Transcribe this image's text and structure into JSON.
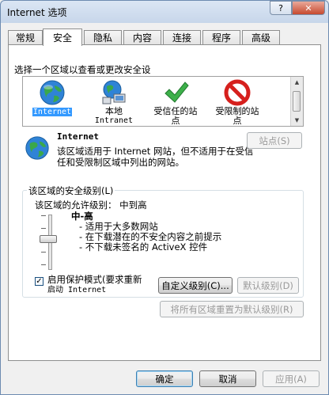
{
  "window": {
    "title": "Internet 选项",
    "help": "?",
    "close": "✕"
  },
  "tabs": [
    "常规",
    "安全",
    "隐私",
    "内容",
    "连接",
    "程序",
    "高级"
  ],
  "zones_label": "选择一个区域以查看或更改安全设",
  "zones": [
    {
      "label": "Internet",
      "icon": "globe-icon"
    },
    {
      "label": "本地",
      "label2": "Intranet",
      "icon": "intranet-globe-icon"
    },
    {
      "label": "受信任的站",
      "label2": "点",
      "icon": "checkmark-icon"
    },
    {
      "label": "受限制的站",
      "label2": "点",
      "icon": "restricted-icon"
    }
  ],
  "zone_info": {
    "title": "Internet",
    "desc": "该区域适用于 Internet 网站，但不适用于在受信任和受限制区域中列出的网站。",
    "sites_button": "站点(S)"
  },
  "security_level": {
    "group_title": "该区域的安全级别(L)",
    "allowed": "该区域的允许级别： 中到高",
    "level": "中-高",
    "bullets": [
      "- 适用于大多数网站",
      "- 在下载潜在的不安全内容之前提示",
      "- 不下载未签名的 ActiveX 控件"
    ],
    "protected_mode_line1": "启用保护模式(要求重新",
    "protected_mode_line2": "启动 Internet",
    "protected_mode_checked": true,
    "custom_button": "自定义级别(C)...",
    "default_button": "默认级别(D)"
  },
  "reset_all_button": "将所有区域重置为默认级别(R)",
  "footer": {
    "ok": "确定",
    "cancel": "取消",
    "apply": "应用(A)"
  }
}
